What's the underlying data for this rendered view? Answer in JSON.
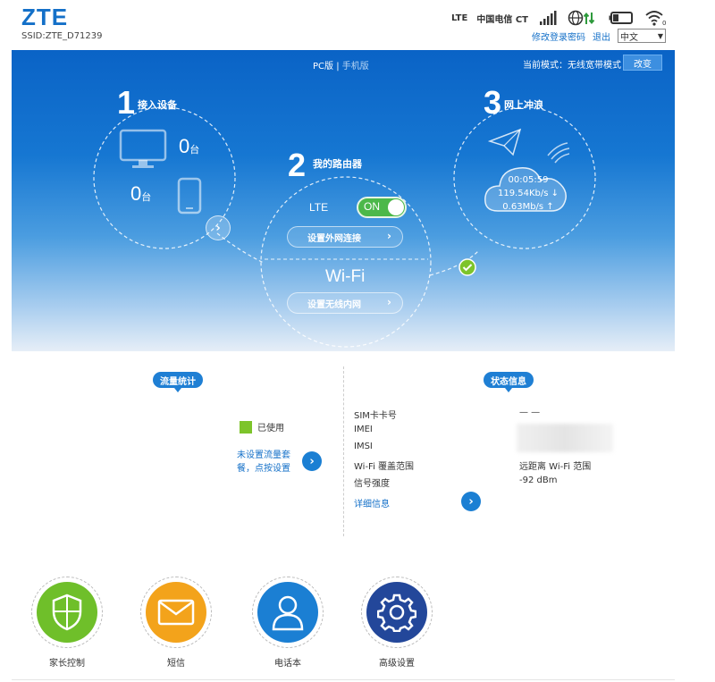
{
  "header": {
    "logo": "ZTE",
    "ssid": "SSID:ZTE_D71239",
    "network_type": "LTE",
    "carrier": "中国电信 CT",
    "change_password": "修改登录密码",
    "logout": "退出",
    "language": "中文"
  },
  "hero": {
    "view_pc": "PC版",
    "separator": "|",
    "view_mobile": "手机版",
    "mode_label": "当前模式：",
    "mode_value": "无线宽带模式",
    "mode_button": "改变",
    "step1": {
      "num": "1",
      "label": "接入设备",
      "pc_count": "0",
      "phone_count": "0",
      "unit": "台"
    },
    "step2": {
      "num": "2",
      "label": "我的路由器",
      "lte_label": "LTE",
      "toggle": "ON",
      "wan_button": "设置外网连接",
      "wifi_title": "Wi-Fi",
      "wlan_button": "设置无线内网"
    },
    "step3": {
      "num": "3",
      "label": "网上冲浪",
      "duration": "00:05:59",
      "download": "119.54Kb/s ↓",
      "upload": "0.63Mb/s ↑"
    }
  },
  "traffic": {
    "title": "流量统计",
    "used_label": "已使用",
    "unset_text": "未设置流量套餐，点按设置"
  },
  "status": {
    "title": "状态信息",
    "rows": [
      {
        "label": "SIM卡卡号",
        "value": "— —"
      },
      {
        "label": "IMEI",
        "value": ""
      },
      {
        "label": "IMSI",
        "value": ""
      },
      {
        "label": "Wi-Fi 覆盖范围",
        "value": "远距离 Wi-Fi 范围"
      },
      {
        "label": "信号强度",
        "value": "-92 dBm"
      }
    ],
    "detail_link": "详细信息"
  },
  "apps": [
    {
      "label": "家长控制",
      "color": "#6fbf2a",
      "icon": "shield-icon"
    },
    {
      "label": "短信",
      "color": "#f3a31b",
      "icon": "envelope-icon"
    },
    {
      "label": "电话本",
      "color": "#1b7fd3",
      "icon": "contact-icon"
    },
    {
      "label": "高级设置",
      "color": "#23479a",
      "icon": "gear-icon"
    }
  ]
}
